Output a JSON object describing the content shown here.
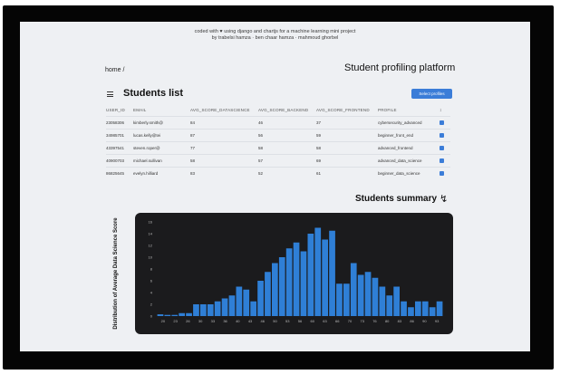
{
  "credit": {
    "line1": "coded with ♥ using django and chartjs for a machine learning mini project",
    "line2": "by trabelsi hamza · ben chaar hamza · mahmoud ghorbel"
  },
  "breadcrumb": "home /",
  "app_title": "Student profiling platform",
  "students": {
    "title": "Students list",
    "select_button": "Select profiles",
    "columns": [
      "USER_ID",
      "EMAIL",
      "AVG_SCORE_DATASCIENCE",
      "AVG_SCORE_BACKEND",
      "AVG_SCORE_FRONTEND",
      "PROFILE"
    ],
    "rows": [
      [
        "23058306",
        "kimberly.smith@",
        "84",
        "46",
        "37",
        "cybersecurity_advanced"
      ],
      [
        "34985701",
        "lucas.kelly@tei",
        "87",
        "56",
        "59",
        "beginner_front_end"
      ],
      [
        "43397541",
        "steven.roper@",
        "77",
        "58",
        "58",
        "advanced_frontend"
      ],
      [
        "40900703",
        "michael.sullivan",
        "58",
        "57",
        "69",
        "advanced_data_science"
      ],
      [
        "86825645",
        "evelyn.hilliard",
        "83",
        "52",
        "61",
        "beginner_data_science"
      ]
    ]
  },
  "summary": {
    "title": "Students summary",
    "bolt_icon": "lightning-bolt-icon"
  },
  "chart_data": {
    "type": "bar",
    "ylabel": "Distribution of Average Data Science Score",
    "ylim": [
      0,
      16
    ],
    "yticks": [
      "0",
      "2",
      "4",
      "6",
      "8",
      "10",
      "12",
      "14",
      "16"
    ],
    "xtick_labels": [
      "20",
      "23",
      "26",
      "30",
      "33",
      "36",
      "40",
      "43",
      "46",
      "50",
      "53",
      "56",
      "60",
      "63",
      "66",
      "70",
      "73",
      "76",
      "80",
      "83",
      "86",
      "90",
      "93"
    ],
    "values": [
      0.3,
      0.2,
      0.2,
      0.5,
      0.5,
      2,
      2,
      2,
      2.5,
      3,
      3.5,
      5,
      4.5,
      2.5,
      6,
      7.5,
      9,
      10,
      11.5,
      12.5,
      11,
      14,
      15,
      13,
      14.5,
      5.5,
      5.5,
      9,
      7,
      7.5,
      6.5,
      5,
      3.5,
      5,
      2.5,
      1.5,
      2.5,
      2.5,
      1.5,
      2.5
    ],
    "bar_color": "#2f7fd6",
    "background": "#1b1b1d",
    "grid": false
  }
}
